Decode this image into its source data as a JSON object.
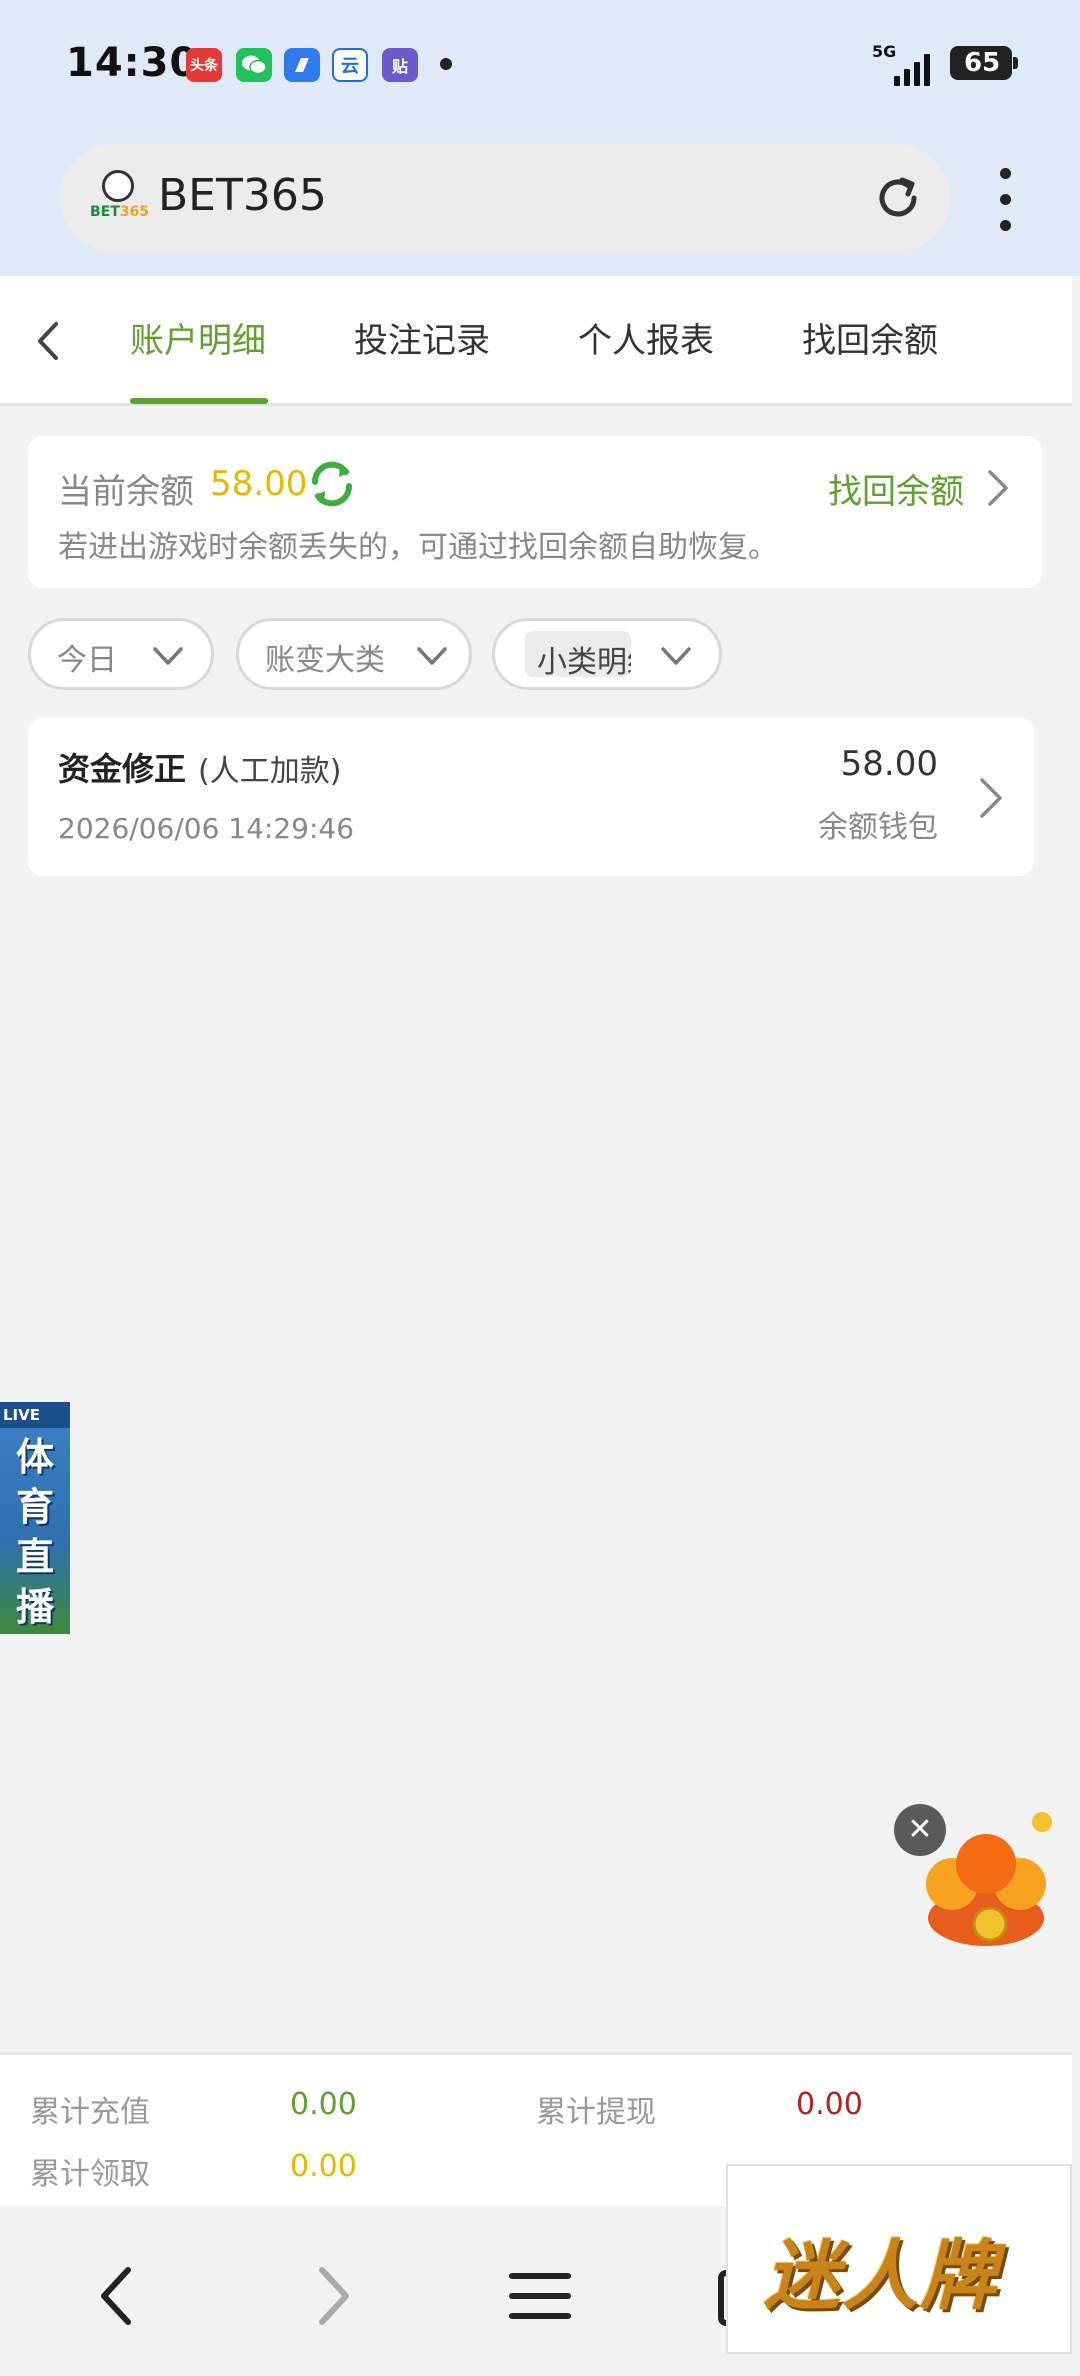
{
  "status_bar": {
    "time": "14:30",
    "notifications": [
      {
        "icon": "toutiao-icon",
        "text": "头条",
        "color": "#e53935"
      },
      {
        "icon": "wechat-icon",
        "text": "",
        "color": "#21c25a"
      },
      {
        "icon": "browser-icon",
        "text": "",
        "color": "#2e7bf0"
      },
      {
        "icon": "yun-icon",
        "text": "云",
        "color": "#1d6fe0"
      },
      {
        "icon": "tieba-icon",
        "text": "贴",
        "color": "#6a5acd"
      }
    ],
    "network": "5G",
    "battery": "65"
  },
  "browser": {
    "site_name": "BET365",
    "logo_text_a": "BET",
    "logo_text_b": "365"
  },
  "tabs": [
    {
      "label": "账户明细",
      "active": true
    },
    {
      "label": "投注记录",
      "active": false
    },
    {
      "label": "个人报表",
      "active": false
    },
    {
      "label": "找回余额",
      "active": false
    }
  ],
  "balance": {
    "label": "当前余额",
    "value": "58.00",
    "recover_label": "找回余额",
    "note": "若进出游戏时余额丢失的，可通过找回余额自助恢复。"
  },
  "filters": [
    {
      "label": "今日"
    },
    {
      "label": "账变大类"
    },
    {
      "label": "小类明细"
    }
  ],
  "records": [
    {
      "title": "资金修正",
      "subtitle": "(人工加款)",
      "time": "2026/06/06 14:29:46",
      "amount": "58.00",
      "wallet": "余额钱包"
    }
  ],
  "live_banner": {
    "tag": "LIVE",
    "text": "体育直播"
  },
  "totals": {
    "recharge_label": "累计充值",
    "recharge_value": "0.00",
    "withdraw_label": "累计提现",
    "withdraw_value": "0.00",
    "claim_label": "累计领取",
    "claim_value": "0.00"
  },
  "ad_banner": {
    "text": "迷人牌"
  },
  "colors": {
    "accent": "#5ea12f",
    "balance": "#e6b800",
    "withdraw": "#b22222"
  }
}
